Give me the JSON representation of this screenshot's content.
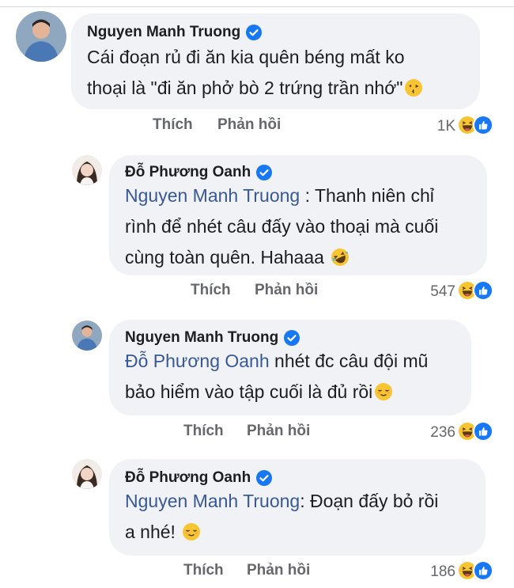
{
  "comments": [
    {
      "author": "Nguyen Manh Truong",
      "lines": [
        "Cái đoạn rủ đi ăn kia quên béng mất ko",
        "thoại là \"đi ăn phở bò 2 trứng trần nhớ\""
      ],
      "like": "Thích",
      "reply": "Phản hồi",
      "count": "1K"
    },
    {
      "author": "Đỗ Phương Oanh",
      "mention": "Nguyen Manh Truong",
      "lines": [
        " : Thanh niên chỉ",
        "rình để nhét câu đấy vào thoại mà cuối",
        "cùng toàn quên. Hahaaa"
      ],
      "like": "Thích",
      "reply": "Phản hồi",
      "count": "547"
    },
    {
      "author": "Nguyen Manh Truong",
      "mention": "Đỗ Phương Oanh",
      "lines": [
        " nhét đc câu đội mũ",
        "bảo hiểm vào tập cuối là đủ rồi"
      ],
      "like": "Thích",
      "reply": "Phản hồi",
      "count": "236"
    },
    {
      "author": "Đỗ Phương Oanh",
      "mention": "Nguyen Manh Truong",
      "lines": [
        ": Đoạn đấy bỏ rồi",
        "a nhé!"
      ],
      "like": "Thích",
      "reply": "Phản hồi",
      "count": "186"
    }
  ],
  "colors": {
    "bubble": "#f0f2f5",
    "mention": "#385898",
    "verified": "#1877f2",
    "meta": "#65676b"
  }
}
